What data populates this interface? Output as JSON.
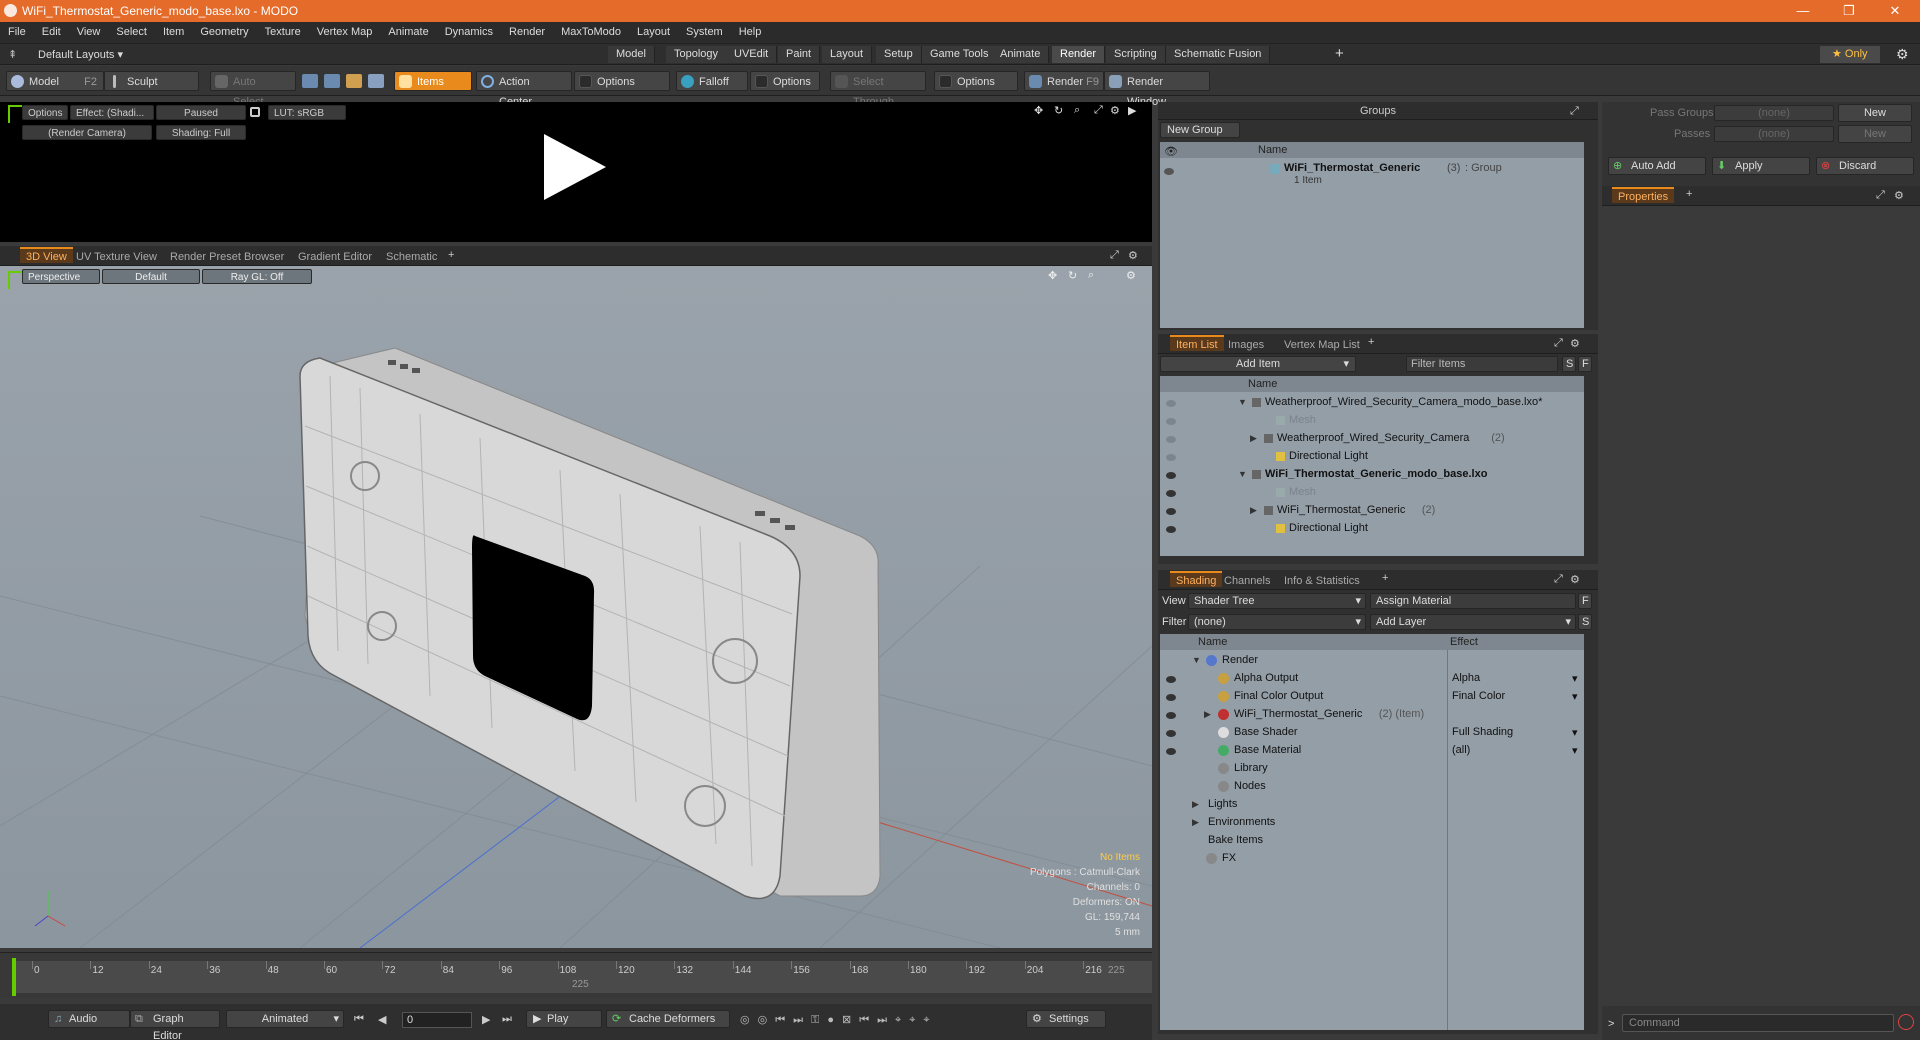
{
  "window": {
    "title": "WiFi_Thermostat_Generic_modo_base.lxo - MODO",
    "minimize": "—",
    "restore": "❐",
    "close": "✕"
  },
  "menu": [
    "File",
    "Edit",
    "View",
    "Select",
    "Item",
    "Geometry",
    "Texture",
    "Vertex Map",
    "Animate",
    "Dynamics",
    "Render",
    "MaxToModo",
    "Layout",
    "System",
    "Help"
  ],
  "layouts": {
    "default": "Default Layouts ▾",
    "tabs": [
      "Model",
      "Topology",
      "UVEdit",
      "Paint",
      "Layout",
      "Setup",
      "Game Tools",
      "Animate",
      "Render",
      "Scripting",
      "Schematic Fusion"
    ],
    "active": "Render",
    "plus": "+",
    "only": "★  Only"
  },
  "toolbar": {
    "model": "Model",
    "model_key": "F2",
    "sculpt": "Sculpt",
    "auto_select": "Auto Select",
    "items": "Items",
    "action_center": "Action Center",
    "options1": "Options",
    "falloff": "Falloff",
    "options2": "Options",
    "select_through": "Select Through",
    "options3": "Options",
    "render": "Render",
    "render_key": "F9",
    "render_window": "Render Window"
  },
  "preview": {
    "options": "Options",
    "effect": "Effect: (Shadi...",
    "paused": "Paused",
    "lut": "LUT: sRGB",
    "camera": "(Render Camera)",
    "shading": "Shading: Full"
  },
  "viewtabs": {
    "tabs": [
      "3D View",
      "UV Texture View",
      "Render Preset Browser",
      "Gradient Editor",
      "Schematic"
    ],
    "active": "3D View",
    "plus": "+"
  },
  "viewport": {
    "perspective": "Perspective",
    "default": "Default",
    "raygl": "Ray GL: Off",
    "stats": {
      "no_items": "No Items",
      "polygons": "Polygons : Catmull-Clark",
      "channels": "Channels: 0",
      "deformers": "Deformers: ON",
      "gl": "GL: 159,744",
      "scale": "5 mm"
    }
  },
  "timeline": {
    "ticks": [
      "0",
      "12",
      "24",
      "36",
      "48",
      "60",
      "72",
      "84",
      "96",
      "108",
      "120",
      "132",
      "144",
      "156",
      "168",
      "180",
      "192",
      "204",
      "216"
    ],
    "end1": "225",
    "end2": "225"
  },
  "bottombar": {
    "audio": "Audio",
    "graph_editor": "Graph Editor",
    "animated": "Animated",
    "frame": "0",
    "play": "Play",
    "cache": "Cache Deformers",
    "settings": "Settings"
  },
  "groups": {
    "title": "Groups",
    "new_group": "New Group",
    "col_name": "Name",
    "item_name": "WiFi_Thermostat_Generic",
    "item_count": "(3)",
    "item_type": ": Group",
    "item_sub": "1 Item"
  },
  "itemlist": {
    "tabs": [
      "Item List",
      "Images",
      "Vertex Map List"
    ],
    "active": "Item List",
    "plus": "+",
    "add_item": "Add Item",
    "filter": "Filter Items",
    "s": "S",
    "f": "F",
    "col_name": "Name",
    "rows": [
      {
        "label": "Weatherproof_Wired_Security_Camera_modo_base.lxo*",
        "indent": 0,
        "bold": false,
        "dim": false,
        "arrow": "▼"
      },
      {
        "label": "Mesh",
        "indent": 2,
        "bold": false,
        "dim": true,
        "arrow": ""
      },
      {
        "label": "Weatherproof_Wired_Security_Camera",
        "extra": "(2)",
        "indent": 1,
        "bold": false,
        "dim": false,
        "arrow": "▶"
      },
      {
        "label": "Directional Light",
        "indent": 2,
        "bold": false,
        "dim": false,
        "arrow": ""
      },
      {
        "label": "WiFi_Thermostat_Generic_modo_base.lxo",
        "indent": 0,
        "bold": true,
        "dim": false,
        "arrow": "▼"
      },
      {
        "label": "Mesh",
        "indent": 2,
        "bold": false,
        "dim": true,
        "arrow": ""
      },
      {
        "label": "WiFi_Thermostat_Generic",
        "extra": "(2)",
        "indent": 1,
        "bold": false,
        "dim": false,
        "arrow": "▶"
      },
      {
        "label": "Directional Light",
        "indent": 2,
        "bold": false,
        "dim": false,
        "arrow": ""
      }
    ]
  },
  "shading": {
    "tabs": [
      "Shading",
      "Channels",
      "Info & Statistics"
    ],
    "active": "Shading",
    "plus": "+",
    "view_label": "View",
    "view_value": "Shader Tree",
    "assign": "Assign Material",
    "f": "F",
    "filter_label": "Filter",
    "filter_value": "(none)",
    "add_layer": "Add Layer",
    "s": "S",
    "col_name": "Name",
    "col_effect": "Effect",
    "rows": [
      {
        "label": "Render",
        "effect": "",
        "indent": 0,
        "arrow": "▼",
        "icon": "#5577cc"
      },
      {
        "label": "Alpha Output",
        "effect": "Alpha",
        "indent": 1,
        "arrow": "",
        "icon": "#c8a040"
      },
      {
        "label": "Final Color Output",
        "effect": "Final Color",
        "indent": 1,
        "arrow": "",
        "icon": "#c8a040"
      },
      {
        "label": "WiFi_Thermostat_Generic",
        "extra": "(2) (Item)",
        "effect": "",
        "indent": 1,
        "arrow": "▶",
        "icon": "#c03030"
      },
      {
        "label": "Base Shader",
        "effect": "Full Shading",
        "indent": 1,
        "arrow": "",
        "icon": "#dddddd"
      },
      {
        "label": "Base Material",
        "effect": "(all)",
        "indent": 1,
        "arrow": "",
        "icon": "#44aa66"
      },
      {
        "label": "Library",
        "effect": "",
        "indent": 1,
        "arrow": "",
        "icon": "#888888"
      },
      {
        "label": "Nodes",
        "effect": "",
        "indent": 1,
        "arrow": "",
        "icon": "#888888"
      },
      {
        "label": "Lights",
        "effect": "",
        "indent": 0,
        "arrow": "▶",
        "icon": ""
      },
      {
        "label": "Environments",
        "effect": "",
        "indent": 0,
        "arrow": "▶",
        "icon": ""
      },
      {
        "label": "Bake Items",
        "effect": "",
        "indent": 0,
        "arrow": "",
        "icon": ""
      },
      {
        "label": "FX",
        "effect": "",
        "indent": 0,
        "arrow": "",
        "icon": "#888888"
      }
    ]
  },
  "passes": {
    "pass_groups": "Pass Groups",
    "passes": "Passes",
    "none1": "(none)",
    "none2": "(none)",
    "new1": "New",
    "new2": "New",
    "auto_add": "Auto Add",
    "apply": "Apply",
    "discard": "Discard",
    "properties": "Properties",
    "plus": "+"
  },
  "command": {
    "placeholder": "Command",
    "prompt": ">"
  }
}
